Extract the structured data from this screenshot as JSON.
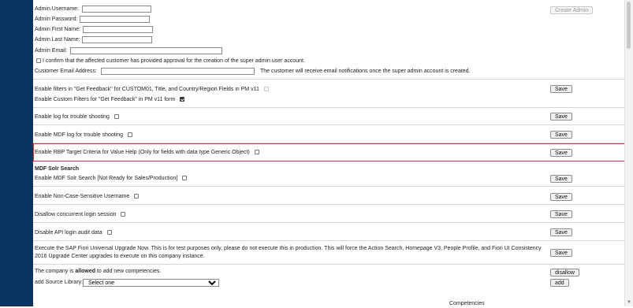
{
  "admin_form": {
    "username_label": "Admin Username:",
    "password_label": "Admin Password:",
    "first_name_label": "Admin First Name:",
    "last_name_label": "Admin Last Name:",
    "email_label": "Admin Email:",
    "create_admin_button": "Create Admin",
    "consent_text": "I confirm that the affected customer has provided approval for the creation of the super admin user account.",
    "customer_email_label": "Customer Email Address:",
    "customer_email_note": "The customer will receive email notifications once the super admin account is created."
  },
  "settings": {
    "feedback_filters_label": "Enable filters in \"Get Feedback\" for CUSTOM01, Title, and Country/Region Fields in PM v11",
    "custom_filters_label": "Enable Custom Filters for \"Get Feedback\" in PM v11 form",
    "trouble_log_label": "Enable log for trouble shooting",
    "mdf_log_label": "Enable MDF log for trouble shooting",
    "rbp_label": "Enable RBP Target Criteria for Value Help (Only for fields with data type Generic Object)",
    "mdf_solr_heading": "MDF Solr Search",
    "mdf_solr_label": "Enable MDF Solr Search [Not Ready for Sales/Production]",
    "non_case_label": "Enable Non-Case-Sensitive Username",
    "concurrent_label": "Disallow concurrent login session",
    "api_audit_label": "Disable API login audit data",
    "upgrade_text_1": "Execute the SAP Fiori Universal Upgrade Now. This is for test purposes only, please do not execute this in production. This will force the Action Search, Homepage V3, People Profile, and Fiori UI Consistency",
    "upgrade_text_2": "2016 Upgrade Center upgrades to execute on this company instance.",
    "save_label": "Save"
  },
  "competencies": {
    "allowed_prefix": "The company is ",
    "allowed_word": "allowed",
    "allowed_suffix": " to add new competencies.",
    "disallow_button": "disallow",
    "source_library_label": "add Source Library:",
    "source_selected": "Select one",
    "add_button": "add",
    "footer_heading": "Competencies"
  },
  "colors": {
    "left_bar": "#0a3563",
    "highlight_border": "#d9333f"
  }
}
